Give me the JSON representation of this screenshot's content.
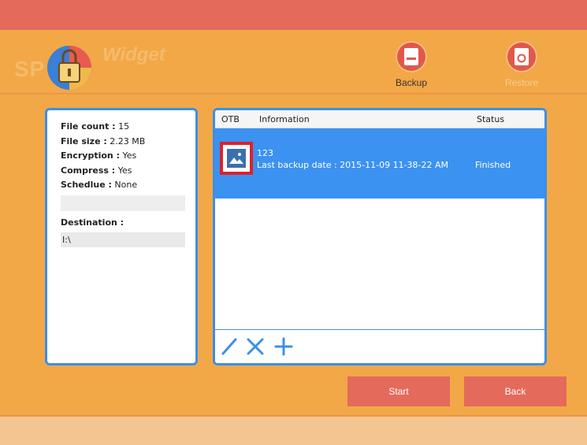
{
  "app": {
    "logo_prefix": "SP",
    "logo_suffix": "Widget"
  },
  "nav": {
    "backup_label": "Backup",
    "restore_label": "Restore"
  },
  "info": {
    "file_count_key": "File count :",
    "file_count_value": "15",
    "file_size_key": "File size :",
    "file_size_value": "2.23 MB",
    "encryption_key": "Encryption :",
    "encryption_value": "Yes",
    "compress_key": "Compress :",
    "compress_value": "Yes",
    "schedule_key": "Schedlue :",
    "schedule_value": "None",
    "destination_label": "Destination :",
    "destination_value": "I:\\"
  },
  "table": {
    "columns": [
      "OTB",
      "Information",
      "Status"
    ],
    "rows": [
      {
        "thumbnail_icon": "image-icon",
        "name": "123",
        "detail": "Last backup date : 2015-11-09 11-38-22 AM",
        "status": "Finished"
      }
    ]
  },
  "toolbar": {
    "icons": [
      "edit-icon",
      "delete-icon",
      "add-icon"
    ]
  },
  "actions": {
    "start_label": "Start",
    "back_label": "Back"
  },
  "colors": {
    "background": "#f2a846",
    "topbar": "#e46a5c",
    "accent": "#3b92f0",
    "button": "#e46a5c",
    "highlight_border": "#e0202a"
  }
}
